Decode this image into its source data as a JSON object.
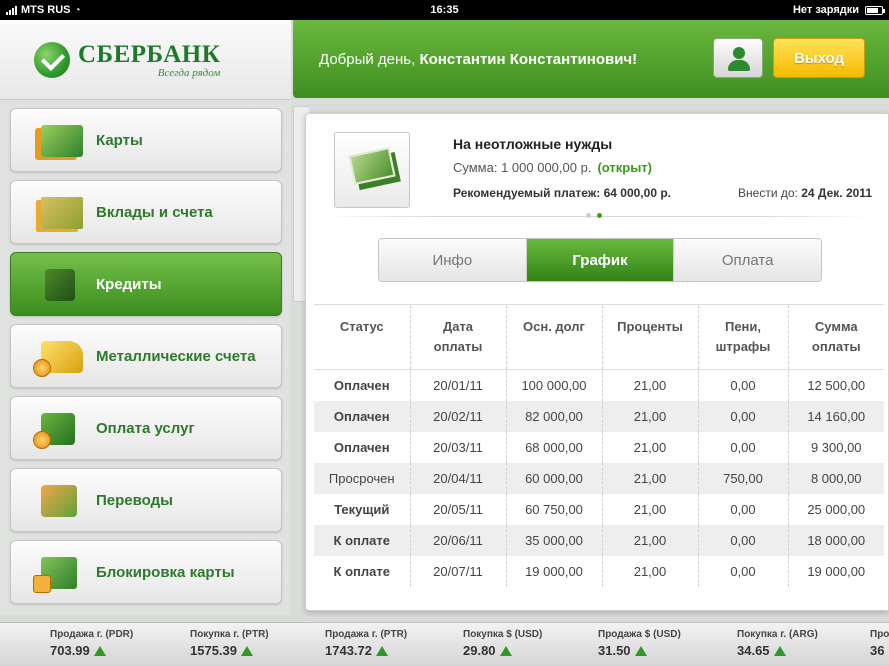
{
  "status_bar": {
    "carrier": "MTS RUS",
    "time": "16:35",
    "battery_text": "Нет зарядки"
  },
  "logo": {
    "brand": "СБЕРБАНК",
    "tagline": "Всегда рядом"
  },
  "header": {
    "greeting_prefix": "Добрый день, ",
    "user_name": "Константин Константинович!",
    "exit_label": "Выход"
  },
  "sidebar": {
    "items": [
      {
        "label": "Карты",
        "icon": "cards-icon",
        "active": false
      },
      {
        "label": "Вклады и счета",
        "icon": "deposits-icon",
        "active": false
      },
      {
        "label": "Кредиты",
        "icon": "credits-icon",
        "active": true
      },
      {
        "label": "Металлические счета",
        "icon": "gold-bars-icon",
        "active": false
      },
      {
        "label": "Оплата услуг",
        "icon": "briefcase-icon",
        "active": false
      },
      {
        "label": "Переводы",
        "icon": "transfer-icon",
        "active": false
      },
      {
        "label": "Блокировка карты",
        "icon": "card-lock-icon",
        "active": false
      }
    ]
  },
  "loan": {
    "title": "На неотложные нужды",
    "sum_label": "Сумма: 1 000 000,00 р.",
    "status": "(открыт)",
    "payment": "Рекомендуемый платеж: 64 000,00 р.",
    "due_label": "Внести до:",
    "due_date": "24 Дек. 2011"
  },
  "tabs": [
    {
      "label": "Инфо",
      "active": false
    },
    {
      "label": "График",
      "active": true
    },
    {
      "label": "Оплата",
      "active": false
    }
  ],
  "schedule": {
    "headers": [
      "Статус",
      "Дата оплаты",
      "Осн. долг",
      "Проценты",
      "Пени, штрафы",
      "Сумма оплаты"
    ],
    "rows": [
      {
        "status": "Оплачен",
        "kind": "paid",
        "date": "20/01/11",
        "principal": "100 000,00",
        "interest": "21,00",
        "penalty": "0,00",
        "total": "12 500,00"
      },
      {
        "status": "Оплачен",
        "kind": "paid",
        "date": "20/02/11",
        "principal": "82 000,00",
        "interest": "21,00",
        "penalty": "0,00",
        "total": "14 160,00"
      },
      {
        "status": "Оплачен",
        "kind": "paid",
        "date": "20/03/11",
        "principal": "68 000,00",
        "interest": "21,00",
        "penalty": "0,00",
        "total": "9 300,00"
      },
      {
        "status": "Просрочен",
        "kind": "overdue",
        "date": "20/04/11",
        "principal": "60 000,00",
        "interest": "21,00",
        "penalty": "750,00",
        "total": "8 000,00"
      },
      {
        "status": "Текущий",
        "kind": "current",
        "date": "20/05/11",
        "principal": "60 750,00",
        "interest": "21,00",
        "penalty": "0,00",
        "total": "25 000,00"
      },
      {
        "status": "К оплате",
        "kind": "topay",
        "date": "20/06/11",
        "principal": "35 000,00",
        "interest": "21,00",
        "penalty": "0,00",
        "total": "18 000,00"
      },
      {
        "status": "К оплате",
        "kind": "topay",
        "date": "20/07/11",
        "principal": "19 000,00",
        "interest": "21,00",
        "penalty": "0,00",
        "total": "19 000,00"
      }
    ]
  },
  "ticker": [
    {
      "label": "Продажа г. (PDR)",
      "value": "703.99"
    },
    {
      "label": "Покупка г. (PTR)",
      "value": "1575.39"
    },
    {
      "label": "Продажа г. (PTR)",
      "value": "1743.72"
    },
    {
      "label": "Покупка $ (USD)",
      "value": "29.80"
    },
    {
      "label": "Продажа $ (USD)",
      "value": "31.50"
    },
    {
      "label": "Покупка г. (ARG)",
      "value": "34.65"
    },
    {
      "label": "Про",
      "value": "36"
    }
  ],
  "colors": {
    "brand_green": "#3f8f21",
    "accent_yellow": "#f6b900",
    "paid": "#2c7a2c",
    "overdue": "#c84b4b",
    "current": "#e08a00",
    "topay": "#4b5fb8"
  }
}
